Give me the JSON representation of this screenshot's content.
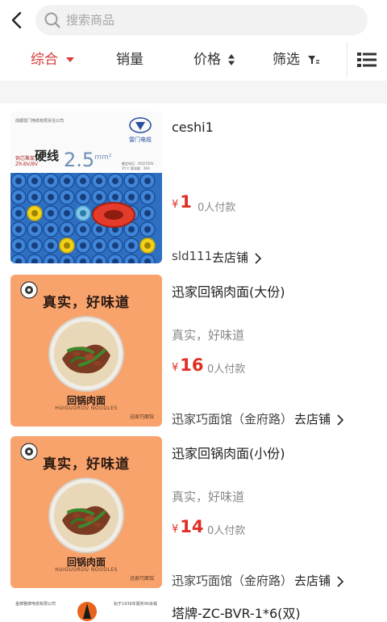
{
  "header": {
    "search_placeholder": "搜索商品"
  },
  "filters": {
    "comprehensive": "综合",
    "sales": "销量",
    "price": "价格",
    "filter": "筛选"
  },
  "colors": {
    "accent": "#d63a34",
    "price": "#e02e24",
    "food_bg": "#f8a26c"
  },
  "products": [
    {
      "name": "ceshi1",
      "currency": "¥",
      "price": "1",
      "paid": "0人付款",
      "shop": "sld111",
      "go_store": "去店铺",
      "image": {
        "company": "成都雷门电缆有限责任公司",
        "brand": "雷门电缆",
        "type": "硬线",
        "type_prefix": "铜芯聚氯",
        "model": "ZR-BV/BV",
        "size": "2.5",
        "unit": "mm²",
        "spec_1": "额定电压：450/750V",
        "spec_2": "25℃ 载流量：26A"
      }
    },
    {
      "name": "迅家回锅肉面(大份)",
      "desc": "真实，好味道",
      "currency": "¥",
      "price": "16",
      "paid": "0人付款",
      "shop": "迅家巧面馆（金府路）",
      "go_store": "去店铺",
      "image": {
        "slogan": "真实，好味道",
        "dish": "回锅肉面",
        "dish_en": "HUIGUOROU NOODLES",
        "maker": "迅家巧面馆"
      }
    },
    {
      "name": "迅家回锅肉面(小份)",
      "desc": "真实，好味道",
      "currency": "¥",
      "price": "14",
      "paid": "0人付款",
      "shop": "迅家巧面馆（金府路）",
      "go_store": "去店铺",
      "image": {
        "slogan": "真实，好味道",
        "dish": "回锅肉面",
        "dish_en": "HUIGUOROU NOODLES",
        "maker": "迅家巧面馆"
      }
    },
    {
      "name": "塔牌-ZC-BVR-1*6(双)",
      "image": {
        "company": "金牌雅牌电缆有限公司",
        "note": "始于1939年服务90余载"
      }
    }
  ]
}
